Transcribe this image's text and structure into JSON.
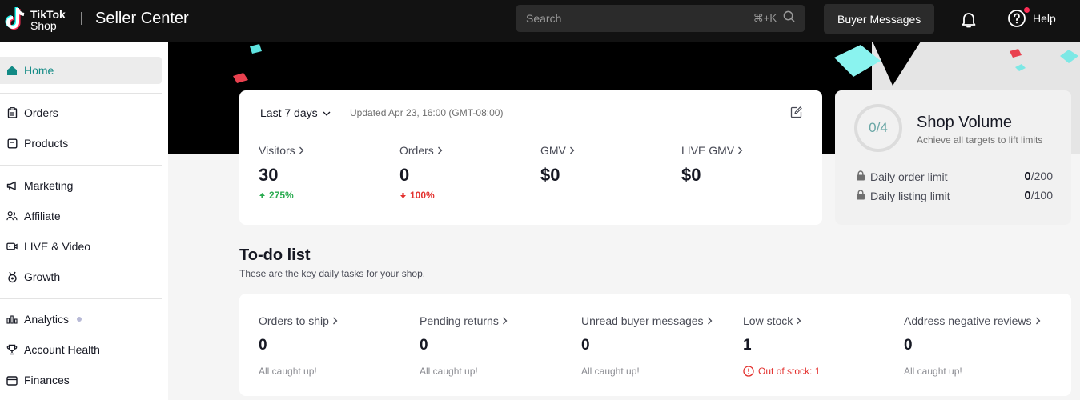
{
  "header": {
    "logo_line1": "TikTok",
    "logo_line2": "Shop",
    "title": "Seller Center",
    "search_placeholder": "Search",
    "search_shortcut": "⌘+K",
    "buyer_messages": "Buyer Messages",
    "help": "Help"
  },
  "sidebar": {
    "items": [
      {
        "label": "Home",
        "icon": "home-icon"
      },
      {
        "label": "Orders",
        "icon": "clipboard-icon"
      },
      {
        "label": "Products",
        "icon": "box-icon"
      },
      {
        "label": "Marketing",
        "icon": "megaphone-icon"
      },
      {
        "label": "Affiliate",
        "icon": "people-icon"
      },
      {
        "label": "LIVE & Video",
        "icon": "video-icon"
      },
      {
        "label": "Growth",
        "icon": "medal-icon"
      },
      {
        "label": "Analytics",
        "icon": "bar-chart-icon"
      },
      {
        "label": "Account Health",
        "icon": "trophy-icon"
      },
      {
        "label": "Finances",
        "icon": "wallet-icon"
      }
    ]
  },
  "stats": {
    "range": "Last 7 days",
    "updated": "Updated Apr 23, 16:00 (GMT-08:00)",
    "metrics": [
      {
        "label": "Visitors",
        "value": "30",
        "change": "275%"
      },
      {
        "label": "Orders",
        "value": "0",
        "change": "100%"
      },
      {
        "label": "GMV",
        "value": "$0"
      },
      {
        "label": "LIVE GMV",
        "value": "$0"
      }
    ]
  },
  "shop_volume": {
    "progress": "0/4",
    "title": "Shop Volume",
    "subtitle": "Achieve all targets to lift limits",
    "limits": [
      {
        "label": "Daily order limit",
        "current": "0",
        "max": "/200"
      },
      {
        "label": "Daily listing limit",
        "current": "0",
        "max": "/100"
      }
    ]
  },
  "todo": {
    "title": "To-do list",
    "subtitle": "These are the key daily tasks for your shop.",
    "items": [
      {
        "label": "Orders to ship",
        "value": "0",
        "status": "All caught up!"
      },
      {
        "label": "Pending returns",
        "value": "0",
        "status": "All caught up!"
      },
      {
        "label": "Unread buyer messages",
        "value": "0",
        "status": "All caught up!"
      },
      {
        "label": "Low stock",
        "value": "1",
        "status": "Out of stock: 1"
      },
      {
        "label": "Address negative reviews",
        "value": "0",
        "status": "All caught up!"
      }
    ]
  },
  "colors": {
    "accent": "#128a85",
    "up": "#2aab50",
    "down": "#e3312e",
    "topbar": "#121212"
  }
}
